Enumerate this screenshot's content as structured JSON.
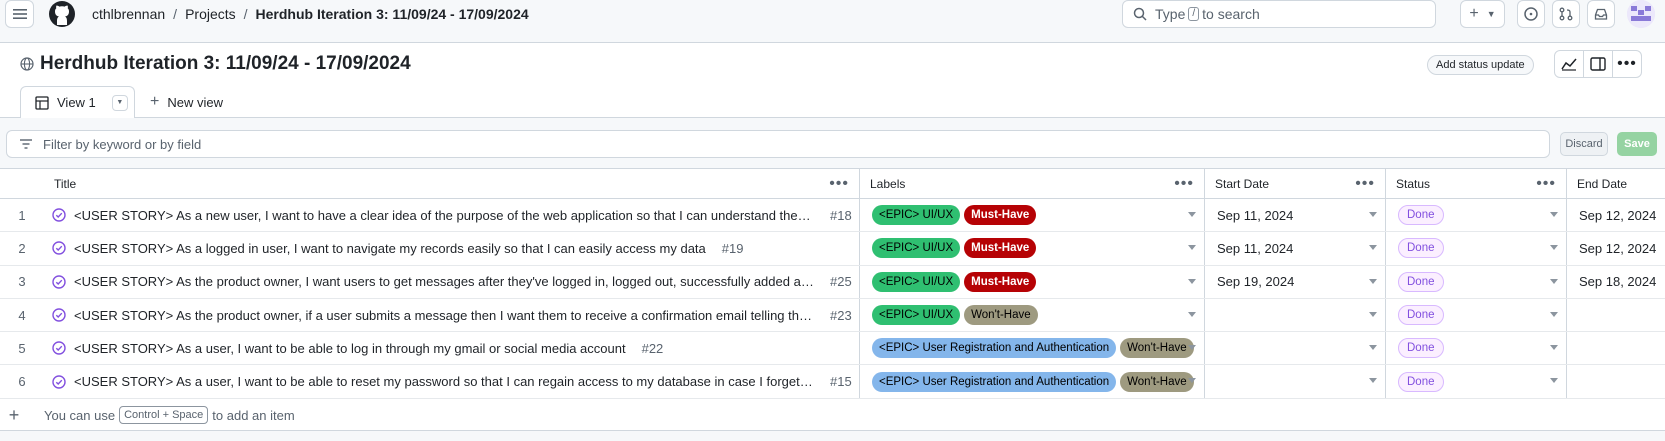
{
  "header": {
    "breadcrumb": [
      "cthlbrennan",
      "Projects",
      "Herdhub Iteration 3: 11/09/24 - 17/09/2024"
    ],
    "search_prefix": "Type",
    "search_key": "/",
    "search_suffix": "to search"
  },
  "project": {
    "title": "Herdhub Iteration 3: 11/09/24 - 17/09/2024",
    "add_status_label": "Add status update"
  },
  "tabs": {
    "active": "View 1",
    "new_view": "New view"
  },
  "filter": {
    "placeholder": "Filter by keyword or by field",
    "discard_label": "Discard",
    "save_label": "Save"
  },
  "columns": {
    "title": "Title",
    "labels": "Labels",
    "start_date": "Start Date",
    "status": "Status",
    "end_date": "End Date"
  },
  "rows": [
    {
      "index": "1",
      "title": "<USER STORY> As a new user, I want to have a clear idea of the purpose of the web application so that I can understand the value t...",
      "issue": "#18",
      "labels": [
        "<EPIC> UI/UX",
        "Must-Have"
      ],
      "start": "Sep 11, 2024",
      "status": "Done",
      "end": "Sep 12, 2024"
    },
    {
      "index": "2",
      "title": "<USER STORY> As a logged in user, I want to navigate my records easily so that I can easily access my data",
      "issue": "#19",
      "labels": [
        "<EPIC> UI/UX",
        "Must-Have"
      ],
      "start": "Sep 11, 2024",
      "status": "Done",
      "end": "Sep 12, 2024"
    },
    {
      "index": "3",
      "title": "<USER STORY> As the product owner, I want users to get messages after they've logged in, logged out, successfully added an anim...",
      "issue": "#25",
      "labels": [
        "<EPIC> UI/UX",
        "Must-Have"
      ],
      "start": "Sep 19, 2024",
      "status": "Done",
      "end": "Sep 18, 2024"
    },
    {
      "index": "4",
      "title": "<USER STORY> As the product owner, if a user submits a message then I want them to receive a confirmation email telling them tha...",
      "issue": "#23",
      "labels": [
        "<EPIC> UI/UX",
        "Won't-Have"
      ],
      "start": "",
      "status": "Done",
      "end": ""
    },
    {
      "index": "5",
      "title": "<USER STORY> As a user, I want to be able to log in through my gmail or social media account",
      "issue": "#22",
      "labels": [
        "<EPIC> User Registration and Authentication",
        "Won't-Have"
      ],
      "start": "",
      "status": "Done",
      "end": ""
    },
    {
      "index": "6",
      "title": "<USER STORY> As a user, I want to be able to reset my password so that I can regain access to my database in case I forget the origi...",
      "issue": "#15",
      "labels": [
        "<EPIC> User Registration and Authentication",
        "Won't-Have"
      ],
      "start": "",
      "status": "Done",
      "end": ""
    }
  ],
  "footer": {
    "prefix": "You can use",
    "shortcut": "Control + Space",
    "suffix": "to add an item"
  },
  "colors": {
    "epic_ui": "#2fbf71",
    "must_have": "#b60205",
    "wont_have": "#9e9a80",
    "epic_reg": "#84b6eb",
    "done": "#8250df"
  }
}
